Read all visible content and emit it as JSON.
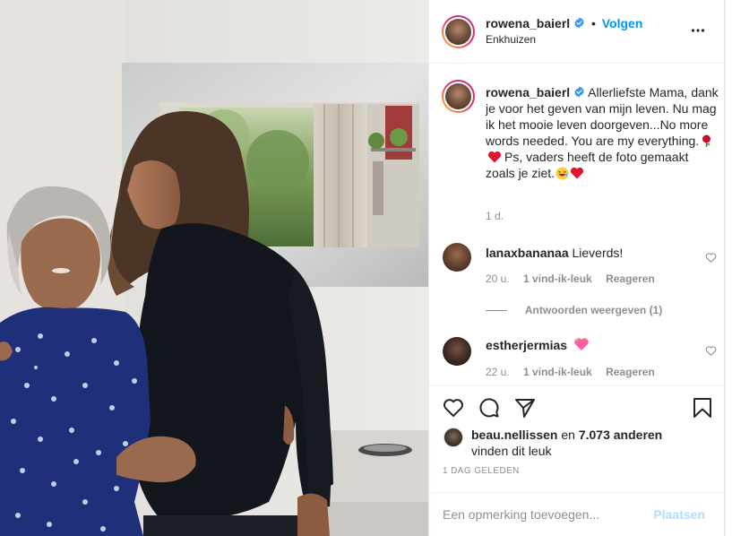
{
  "header": {
    "username": "rowena_baierl",
    "separator": "•",
    "follow_label": "Volgen",
    "location": "Enkhuizen"
  },
  "caption": {
    "username": "rowena_baierl",
    "text_part1": "Allerliefste Mama, dank je voor het geven van mijn leven. Nu mag ik het mooie leven doorgeven...No more words needed. You are my everything.",
    "text_part2": "Ps, vaders heeft de foto gemaakt zoals je ziet.",
    "time": "1 d."
  },
  "comments": [
    {
      "username": "lanaxbananaa",
      "text": "Lieverds!",
      "time": "20 u.",
      "likes": "1 vind-ik-leuk",
      "reply_label": "Reageren",
      "view_replies": "Antwoorden weergeven (1)"
    },
    {
      "username": "estherjermias",
      "text": "",
      "time": "22 u.",
      "likes": "1 vind-ik-leuk",
      "reply_label": "Reageren"
    }
  ],
  "likes": {
    "user": "beau.nellissen",
    "connector": "en",
    "count": "7.073 anderen",
    "suffix": "vinden dit leuk"
  },
  "date": "1 DAG GELEDEN",
  "add_comment": {
    "placeholder": "Een opmerking toevoegen...",
    "post_label": "Plaatsen"
  },
  "colors": {
    "accent": "#0095f6",
    "text": "#262626",
    "muted": "#8e8e8e",
    "border": "#efefef",
    "post_disabled": "#b3dbff"
  },
  "icons": {
    "verified": "verified-badge-icon",
    "more": "more-options-icon",
    "like": "heart-icon",
    "comment": "comment-icon",
    "share": "paper-plane-icon",
    "save": "bookmark-icon"
  }
}
